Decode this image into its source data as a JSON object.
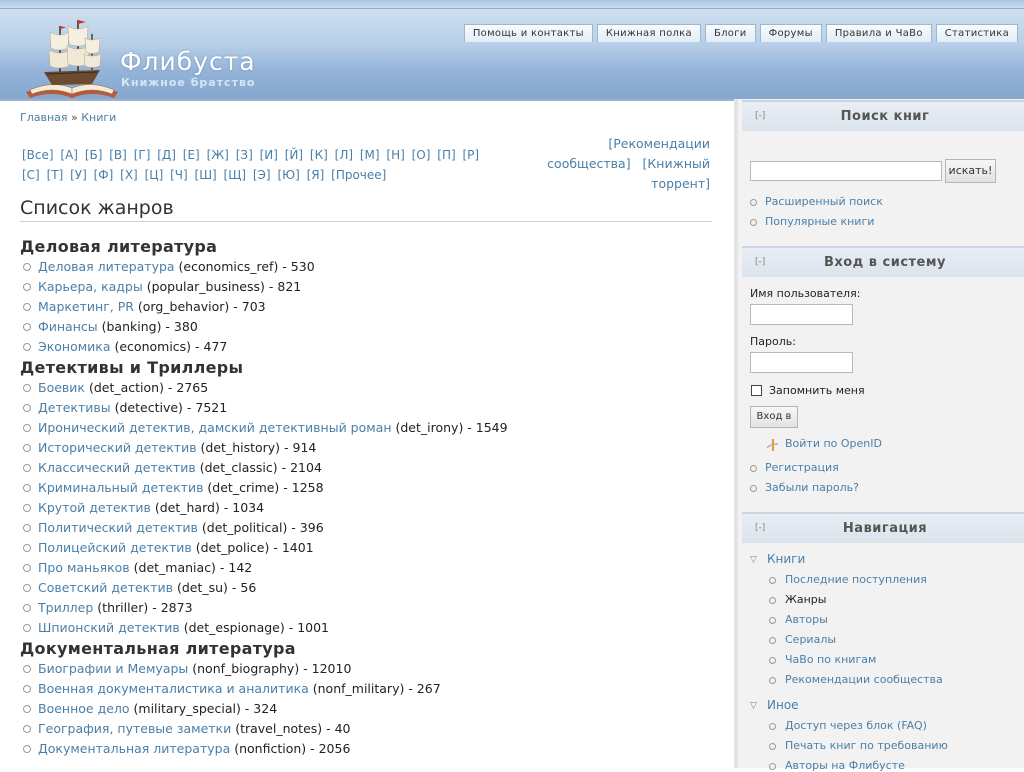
{
  "header": {
    "site_name": "Флибуста",
    "slogan": "Книжное братство",
    "tabs": [
      "Помощь и контакты",
      "Книжная полка",
      "Блоги",
      "Форумы",
      "Правила и ЧаВо",
      "Статистика"
    ]
  },
  "breadcrumb": {
    "home": "Главная",
    "separator": "»",
    "books": "Книги"
  },
  "alphabet": [
    "[Все]",
    "[А]",
    "[Б]",
    "[В]",
    "[Г]",
    "[Д]",
    "[Е]",
    "[Ж]",
    "[З]",
    "[И]",
    "[Й]",
    "[К]",
    "[Л]",
    "[М]",
    "[Н]",
    "[О]",
    "[П]",
    "[Р]",
    "[С]",
    "[Т]",
    "[У]",
    "[Ф]",
    "[Х]",
    "[Ц]",
    "[Ч]",
    "[Ш]",
    "[Щ]",
    "[Э]",
    "[Ю]",
    "[Я]",
    "[Прочее]"
  ],
  "recommend": {
    "line1": "[Рекомендации",
    "line2": "сообщества]",
    "line3": "[Книжный",
    "line4": "торрент]"
  },
  "page_title": "Список жанров",
  "groups": [
    {
      "title": "Деловая литература",
      "items": [
        {
          "name": "Деловая литература",
          "code": " (economics_ref) - 530"
        },
        {
          "name": "Карьера, кадры",
          "code": " (popular_business) - 821"
        },
        {
          "name": "Маркетинг, PR",
          "code": " (org_behavior) - 703"
        },
        {
          "name": "Финансы",
          "code": " (banking) - 380"
        },
        {
          "name": "Экономика",
          "code": " (economics) - 477"
        }
      ]
    },
    {
      "title": "Детективы и Триллеры",
      "items": [
        {
          "name": "Боевик",
          "code": " (det_action) - 2765"
        },
        {
          "name": "Детективы",
          "code": " (detective) - 7521"
        },
        {
          "name": "Иронический детектив, дамский детективный роман",
          "code": " (det_irony) - 1549"
        },
        {
          "name": "Исторический детектив",
          "code": " (det_history) - 914"
        },
        {
          "name": "Классический детектив",
          "code": " (det_classic) - 2104"
        },
        {
          "name": "Криминальный детектив",
          "code": " (det_crime) - 1258"
        },
        {
          "name": "Крутой детектив",
          "code": " (det_hard) - 1034"
        },
        {
          "name": "Политический детектив",
          "code": " (det_political) - 396"
        },
        {
          "name": "Полицейский детектив",
          "code": " (det_police) - 1401"
        },
        {
          "name": "Про маньяков",
          "code": " (det_maniac) - 142"
        },
        {
          "name": "Советский детектив",
          "code": " (det_su) - 56"
        },
        {
          "name": "Триллер",
          "code": " (thriller) - 2873"
        },
        {
          "name": "Шпионский детектив",
          "code": " (det_espionage) - 1001"
        }
      ]
    },
    {
      "title": "Документальная литература",
      "items": [
        {
          "name": "Биографии и Мемуары",
          "code": " (nonf_biography) - 12010"
        },
        {
          "name": "Военная документалистика и аналитика",
          "code": " (nonf_military) - 267"
        },
        {
          "name": "Военное дело",
          "code": " (military_special) - 324"
        },
        {
          "name": "География, путевые заметки",
          "code": " (travel_notes) - 40"
        },
        {
          "name": "Документальная литература",
          "code": " (nonfiction) - 2056"
        }
      ]
    }
  ],
  "sidebar": {
    "collapse_label": "[-]",
    "search": {
      "title": "Поиск книг",
      "input_value": "",
      "button": "искать!",
      "links": [
        "Расширенный поиск",
        "Популярные книги"
      ]
    },
    "login": {
      "title": "Вход в систему",
      "username_label": "Имя пользователя:",
      "password_label": "Пароль:",
      "remember": "Запомнить меня",
      "button": "Вход в",
      "openid": "Войти по OpenID",
      "links": [
        "Регистрация",
        "Забыли пароль?"
      ]
    },
    "navigation": {
      "title": "Навигация",
      "books": "Книги",
      "books_items": [
        "Последние поступления",
        "Жанры",
        "Авторы",
        "Сериалы",
        "ЧаВо по книгам",
        "Рекомендации сообщества"
      ],
      "other": "Иное",
      "other_items": [
        "Доступ через блок (FAQ)",
        "Печать книг по требованию",
        "Авторы на Флибусте"
      ]
    }
  }
}
